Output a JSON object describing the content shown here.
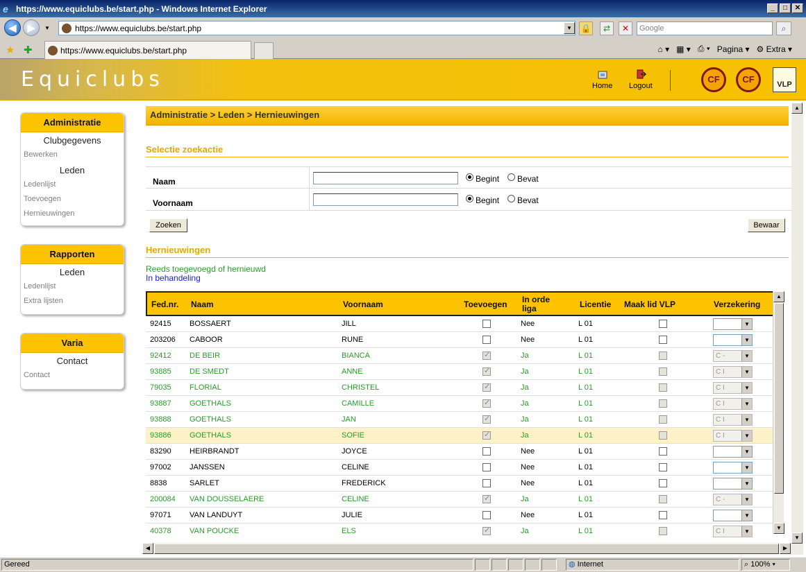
{
  "window": {
    "title": "https://www.equiclubs.be/start.php - Windows Internet Explorer",
    "address": "https://www.equiclubs.be/start.php",
    "search_placeholder": "Google",
    "tab_title": "https://www.equiclubs.be/start.php",
    "cmd_pagina": "Pagina",
    "cmd_extra": "Extra"
  },
  "header": {
    "site_title": "Equiclubs",
    "home_label": "Home",
    "logout_label": "Logout",
    "logo_vlp": "VLP"
  },
  "sidebar": {
    "administratie": {
      "title": "Administratie",
      "sections": [
        {
          "title": "Clubgegevens",
          "items": [
            "Bewerken"
          ]
        },
        {
          "title": "Leden",
          "items": [
            "Ledenlijst",
            "Toevoegen",
            "Hernieuwingen"
          ]
        }
      ]
    },
    "rapporten": {
      "title": "Rapporten",
      "section_title": "Leden",
      "items": [
        "Ledenlijst",
        "Extra lijsten"
      ]
    },
    "varia": {
      "title": "Varia",
      "section_title": "Contact",
      "items": [
        "Contact"
      ]
    }
  },
  "main": {
    "breadcrumb": "Administratie > Leden > Hernieuwingen",
    "search_title": "Selectie zoekactie",
    "fields": [
      {
        "label": "Naam",
        "value": "",
        "opt1": "Begint",
        "opt2": "Bevat",
        "selected": "Begint"
      },
      {
        "label": "Voornaam",
        "value": "",
        "opt1": "Begint",
        "opt2": "Bevat",
        "selected": "Begint"
      }
    ],
    "search_button": "Zoeken",
    "save_button": "Bewaar",
    "results_title": "Hernieuwingen",
    "legend_green": "Reeds toegevoegd of hernieuwd",
    "legend_blue": "In behandeling",
    "colors": {
      "accent": "#fdc300",
      "green": "#2a9a2a",
      "blue": "#1a1adc"
    }
  },
  "grid": {
    "columns": [
      "Fed.nr.",
      "Naam",
      "Voornaam",
      "Toevoegen",
      "In orde liga",
      "Licentie",
      "Maak lid VLP",
      "Verzekering"
    ],
    "rows": [
      {
        "fed": "92415",
        "naam": "BOSSAERT",
        "voornaam": "JILL",
        "toevoegen": false,
        "liga": "Nee",
        "licentie": "L 01",
        "vlp": false,
        "verz": "",
        "status": "normal"
      },
      {
        "fed": "203206",
        "naam": "CABOOR",
        "voornaam": "RUNE",
        "toevoegen": false,
        "liga": "Nee",
        "licentie": "L 01",
        "vlp": false,
        "verz": "",
        "status": "normal"
      },
      {
        "fed": "92412",
        "naam": "DE BEIR",
        "voornaam": "BIANCA",
        "toevoegen": true,
        "liga": "Ja",
        "licentie": "L 01",
        "vlp": false,
        "verz": "C -",
        "status": "done"
      },
      {
        "fed": "93885",
        "naam": "DE SMEDT",
        "voornaam": "ANNE",
        "toevoegen": true,
        "liga": "Ja",
        "licentie": "L 01",
        "vlp": false,
        "verz": "C I",
        "status": "done"
      },
      {
        "fed": "79035",
        "naam": "FLORIAL",
        "voornaam": "CHRISTEL",
        "toevoegen": true,
        "liga": "Ja",
        "licentie": "L 01",
        "vlp": false,
        "verz": "C I",
        "status": "done"
      },
      {
        "fed": "93887",
        "naam": "GOETHALS",
        "voornaam": "CAMILLE",
        "toevoegen": true,
        "liga": "Ja",
        "licentie": "L 01",
        "vlp": false,
        "verz": "C I",
        "status": "done"
      },
      {
        "fed": "93888",
        "naam": "GOETHALS",
        "voornaam": "JAN",
        "toevoegen": true,
        "liga": "Ja",
        "licentie": "L 01",
        "vlp": false,
        "verz": "C I",
        "status": "done"
      },
      {
        "fed": "93886",
        "naam": "GOETHALS",
        "voornaam": "SOFIE",
        "toevoegen": true,
        "liga": "Ja",
        "licentie": "L 01",
        "vlp": false,
        "verz": "C I",
        "status": "done",
        "highlight": true
      },
      {
        "fed": "83290",
        "naam": "HEIRBRANDT",
        "voornaam": "JOYCE",
        "toevoegen": false,
        "liga": "Nee",
        "licentie": "L 01",
        "vlp": false,
        "verz": "",
        "status": "normal"
      },
      {
        "fed": "97002",
        "naam": "JANSSEN",
        "voornaam": "CELINE",
        "toevoegen": false,
        "liga": "Nee",
        "licentie": "L 01",
        "vlp": false,
        "verz": "",
        "status": "normal"
      },
      {
        "fed": "8838",
        "naam": "SARLET",
        "voornaam": "FREDERICK",
        "toevoegen": false,
        "liga": "Nee",
        "licentie": "L 01",
        "vlp": false,
        "verz": "",
        "status": "normal"
      },
      {
        "fed": "200084",
        "naam": "VAN DOUSSELAERE",
        "voornaam": "CELINE",
        "toevoegen": true,
        "liga": "Ja",
        "licentie": "L 01",
        "vlp": false,
        "verz": "C -",
        "status": "done"
      },
      {
        "fed": "97071",
        "naam": "VAN LANDUYT",
        "voornaam": "JULIE",
        "toevoegen": false,
        "liga": "Nee",
        "licentie": "L 01",
        "vlp": false,
        "verz": "",
        "status": "normal"
      },
      {
        "fed": "40378",
        "naam": "VAN POUCKE",
        "voornaam": "ELS",
        "toevoegen": true,
        "liga": "Ja",
        "licentie": "L 01",
        "vlp": false,
        "verz": "C I",
        "status": "done"
      }
    ]
  },
  "statusbar": {
    "status": "Gereed",
    "zone": "Internet",
    "zoom": "100%"
  }
}
